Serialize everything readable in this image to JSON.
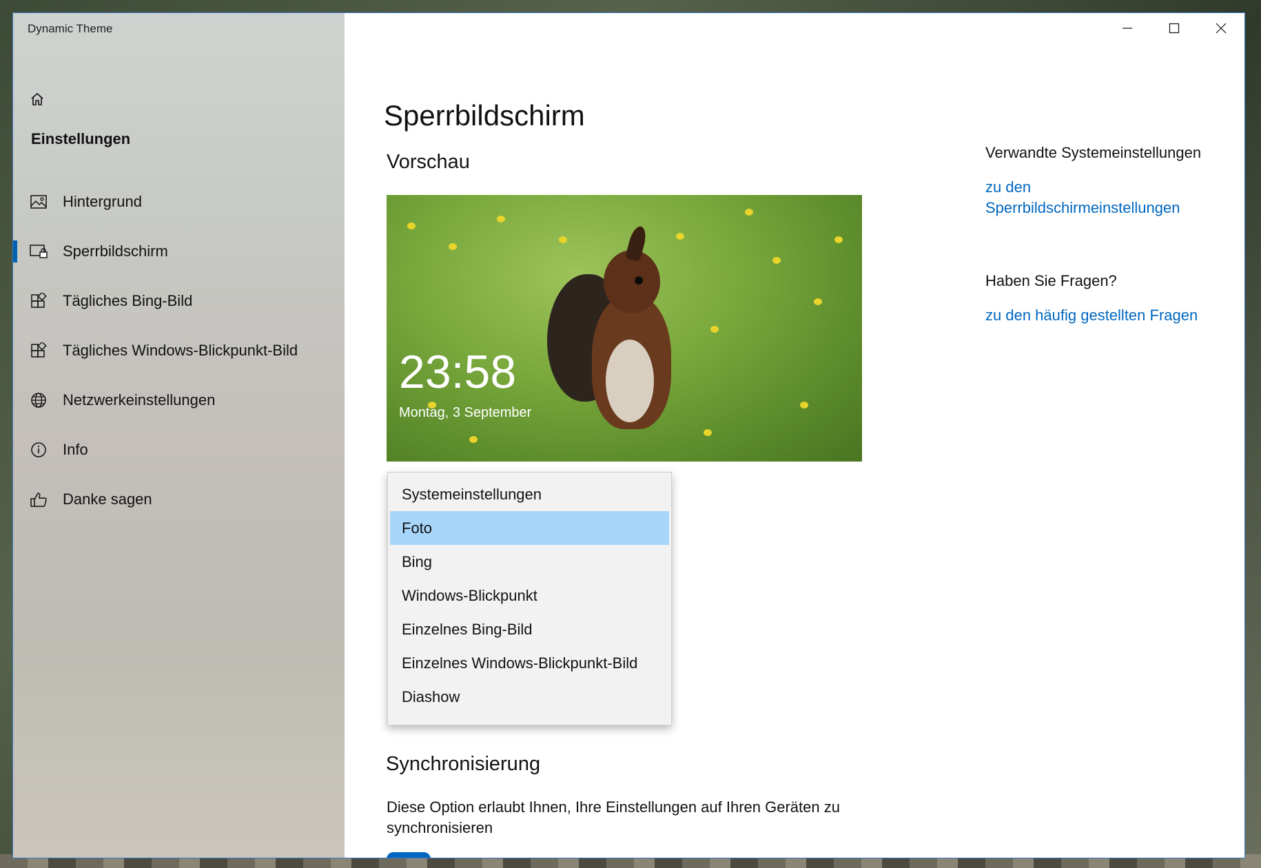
{
  "window": {
    "title": "Dynamic Theme"
  },
  "sidebar": {
    "home_icon": "home-icon",
    "section_title": "Einstellungen",
    "items": [
      {
        "label": "Hintergrund",
        "icon": "picture-icon",
        "active": false
      },
      {
        "label": "Sperrbildschirm",
        "icon": "lockscreen-icon",
        "active": true
      },
      {
        "label": "Tägliches Bing-Bild",
        "icon": "apps-add-icon",
        "active": false
      },
      {
        "label": "Tägliches Windows-Blickpunkt-Bild",
        "icon": "apps-add-icon",
        "active": false
      },
      {
        "label": "Netzwerkeinstellungen",
        "icon": "globe-icon",
        "active": false
      },
      {
        "label": "Info",
        "icon": "info-icon",
        "active": false
      },
      {
        "label": "Danke sagen",
        "icon": "thumbs-up-icon",
        "active": false
      }
    ]
  },
  "main": {
    "title": "Sperrbildschirm",
    "preview_title": "Vorschau",
    "preview": {
      "time": "23:58",
      "date": "Montag, 3 September"
    },
    "dropdown": {
      "options": [
        "Systemeinstellungen",
        "Foto",
        "Bing",
        "Windows-Blickpunkt",
        "Einzelnes Bing-Bild",
        "Einzelnes Windows-Blickpunkt-Bild",
        "Diashow"
      ],
      "selected": "Foto"
    },
    "sync_title": "Synchronisierung",
    "sync_description": "Diese Option erlaubt Ihnen, Ihre Einstellungen auf Ihren Geräten zu synchronisieren"
  },
  "related": {
    "heading": "Verwandte Systemeinstellungen",
    "link_line1": "zu den",
    "link_line2": "Sperrbildschirmeinstellungen"
  },
  "questions": {
    "heading": "Haben Sie Fragen?",
    "link": "zu den häufig gestellten Fragen"
  },
  "colors": {
    "accent": "#0067c0",
    "selection": "#a8d6fb",
    "active_indicator": "#0063b1"
  }
}
